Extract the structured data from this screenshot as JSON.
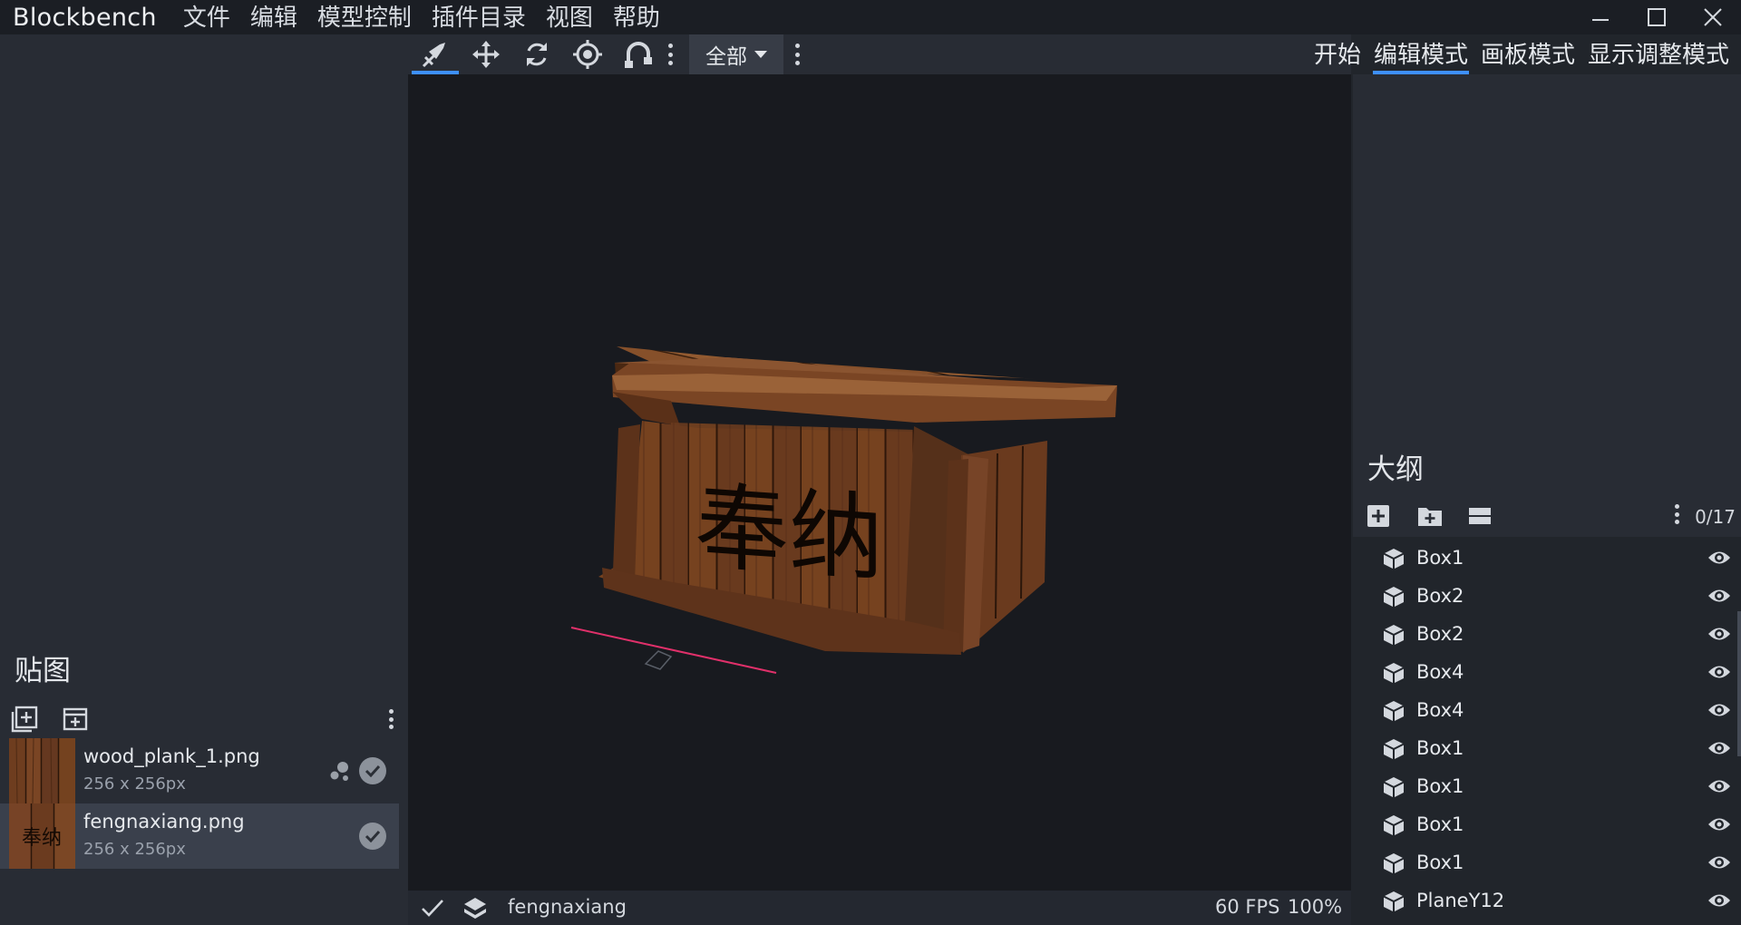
{
  "app": {
    "title": "Blockbench"
  },
  "menu": [
    "文件",
    "编辑",
    "模型控制",
    "插件目录",
    "视图",
    "帮助"
  ],
  "toolbar": {
    "tools": [
      "move-tool-icon",
      "resize-tool-icon",
      "rotate-tool-icon",
      "pivot-tool-icon",
      "vertex-snap-icon"
    ],
    "selected_tool": "move-tool-icon",
    "mode_select": "全部"
  },
  "mode_tabs": [
    {
      "label": "开始",
      "active": false
    },
    {
      "label": "编辑模式",
      "active": true
    },
    {
      "label": "画板模式",
      "active": false
    },
    {
      "label": "显示调整模式",
      "active": false
    }
  ],
  "textures": {
    "heading": "贴图",
    "items": [
      {
        "name": "wood_plank_1.png",
        "size": "256 x 256px",
        "active": false,
        "has_particle": true
      },
      {
        "name": "fengnaxiang.png",
        "size": "256 x 256px",
        "active": true,
        "has_particle": false
      }
    ]
  },
  "viewport": {
    "front_text": "奉纳",
    "colors": {
      "wood": "#6b3d1d",
      "background": "#181a1f",
      "axis_x": "#e0306a"
    }
  },
  "status": {
    "model_name": "fengnaxiang",
    "fps": "60 FPS",
    "zoom": "100%"
  },
  "outliner": {
    "heading": "大纲",
    "count": "0/17",
    "items": [
      "Box1",
      "Box2",
      "Box2",
      "Box4",
      "Box4",
      "Box1",
      "Box1",
      "Box1",
      "Box1",
      "PlaneY12"
    ]
  },
  "colors": {
    "accent": "#3e90ff",
    "panel": "#282c34",
    "titlebar": "#1b1e24"
  }
}
